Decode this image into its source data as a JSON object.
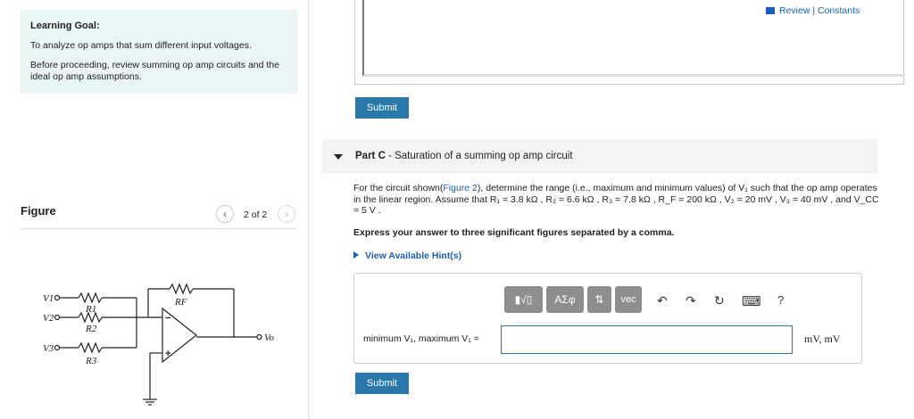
{
  "learning_goal": {
    "title": "Learning Goal:",
    "line1": "To analyze op amps that sum different input voltages.",
    "line2": "Before proceeding, review summing op amp circuits and the ideal op amp assumptions."
  },
  "figure": {
    "label": "Figure",
    "page": "2 of 2",
    "prev_icon": "chevron-left-icon",
    "next_icon": "chevron-right-icon",
    "circuit": {
      "v1": "V1",
      "v2": "V2",
      "v3": "V3",
      "r1": "R1",
      "r2": "R2",
      "r3": "R3",
      "rf": "RF",
      "vo": "Vo",
      "minus": "−",
      "plus": "+"
    }
  },
  "header": {
    "review_constants": "Review | Constants"
  },
  "submit_label": "Submit",
  "part_c": {
    "part": "Part C",
    "title": " - Saturation of a summing op amp circuit",
    "problem_pre": "For the circuit shown(",
    "figure_link": "Figure 2",
    "problem_post": "), determine the range (i.e., maximum and minimum values) of V₁ such that the op amp operates in the linear region. Assume that R₁ = 3.8 kΩ , R₂ = 6.6 kΩ , R₃ = 7.8 kΩ , R_F = 200 kΩ , V₂ = 20 mV , V₃ = 40 mV , and V_CC = 5 V .",
    "instruction": "Express your answer to three significant figures separated by a comma.",
    "hint": "View Available Hint(s)"
  },
  "answer": {
    "label": "minimum V₁, maximum V₁ =",
    "value": "",
    "units": "mV, mV",
    "toolbar": {
      "templates": "▮√▯",
      "greek": "ΑΣφ",
      "arrows": "⇅",
      "vec": "vec",
      "undo": "↶",
      "redo": "↷",
      "reset": "↻",
      "keyboard": "⌨",
      "help": "?"
    }
  }
}
